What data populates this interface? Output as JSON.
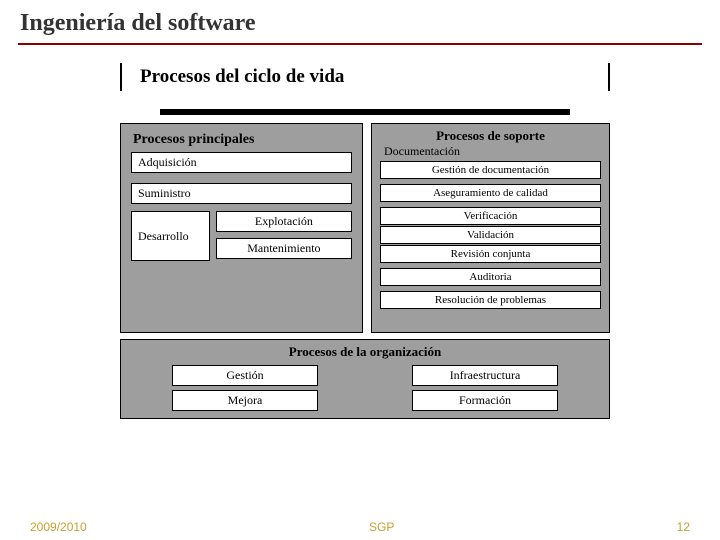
{
  "slide": {
    "title": "Ingeniería del software",
    "subtitle": "Procesos del ciclo de vida"
  },
  "principales": {
    "heading": "Procesos principales",
    "adquisicion": "Adquisición",
    "suministro": "Suministro",
    "desarrollo": "Desarrollo",
    "explotacion": "Explotación",
    "mantenimiento": "Mantenimiento"
  },
  "soporte": {
    "heading": "Procesos de soporte",
    "documentacion_label": "Documentación",
    "gestion_doc": "Gestión de documentación",
    "aseguramiento": "Aseguramiento de calidad",
    "verificacion": "Verificación",
    "validacion": "Validación",
    "revision": "Revisión conjunta",
    "auditoria": "Auditoria",
    "resolucion": "Resolución de problemas"
  },
  "organizacion": {
    "heading": "Procesos de la organización",
    "gestion": "Gestión",
    "mejora": "Mejora",
    "infraestructura": "Infraestructura",
    "formacion": "Formación"
  },
  "footer": {
    "left": "2009/2010",
    "center": "SGP",
    "right": "12"
  }
}
